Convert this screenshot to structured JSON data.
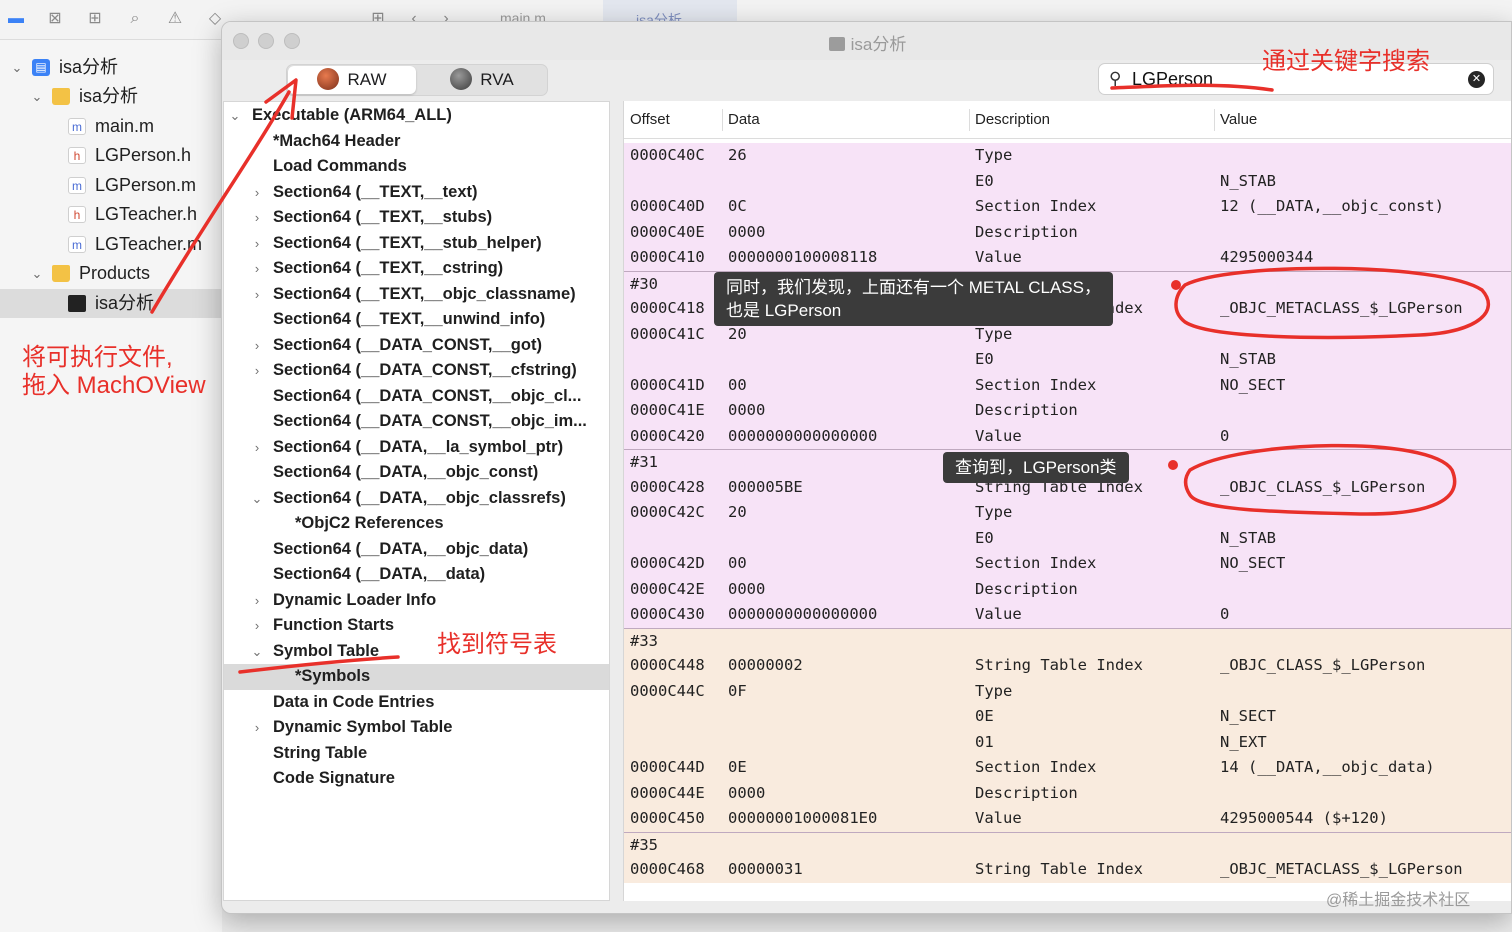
{
  "xcode": {
    "toolbar_icons": [
      "folder-icon",
      "x-square-icon",
      "hierarchy-icon",
      "search-icon",
      "warning-icon",
      "diamond-icon",
      "gear-icon",
      "tag-icon",
      "doc-icon",
      "grid-icon",
      "back-icon",
      "forward-icon"
    ],
    "tab_main": "main.m",
    "tab_isa": "isa分析",
    "navigator": [
      {
        "label": "isa分析",
        "type": "project",
        "chevron": "v"
      },
      {
        "label": "isa分析",
        "type": "folder",
        "chevron": "v"
      },
      {
        "label": "main.m",
        "type": "m"
      },
      {
        "label": "LGPerson.h",
        "type": "h"
      },
      {
        "label": "LGPerson.m",
        "type": "m"
      },
      {
        "label": "LGTeacher.h",
        "type": "h"
      },
      {
        "label": "LGTeacher.m",
        "type": "m"
      },
      {
        "label": "Products",
        "type": "folder",
        "chevron": "v"
      },
      {
        "label": "isa分析",
        "type": "exec",
        "selected": true
      }
    ]
  },
  "machoview": {
    "title": "isa分析",
    "segments": [
      {
        "label": "RAW",
        "selected": true
      },
      {
        "label": "RVA",
        "selected": false
      }
    ],
    "search": {
      "value": "LGPerson",
      "placeholder": "Search"
    },
    "tree": [
      {
        "label": "Executable  (ARM64_ALL)",
        "indent": 0,
        "chevron": "v"
      },
      {
        "label": "*Mach64 Header",
        "indent": 1,
        "chevron": ""
      },
      {
        "label": "Load Commands",
        "indent": 1,
        "chevron": ""
      },
      {
        "label": "Section64 (__TEXT,__text)",
        "indent": 1,
        "chevron": ">"
      },
      {
        "label": "Section64 (__TEXT,__stubs)",
        "indent": 1,
        "chevron": ">"
      },
      {
        "label": "Section64 (__TEXT,__stub_helper)",
        "indent": 1,
        "chevron": ">"
      },
      {
        "label": "Section64 (__TEXT,__cstring)",
        "indent": 1,
        "chevron": ">"
      },
      {
        "label": "Section64 (__TEXT,__objc_classname)",
        "indent": 1,
        "chevron": ">"
      },
      {
        "label": "Section64 (__TEXT,__unwind_info)",
        "indent": 1,
        "chevron": ""
      },
      {
        "label": "Section64 (__DATA_CONST,__got)",
        "indent": 1,
        "chevron": ">"
      },
      {
        "label": "Section64 (__DATA_CONST,__cfstring)",
        "indent": 1,
        "chevron": ">"
      },
      {
        "label": "Section64 (__DATA_CONST,__objc_cl...",
        "indent": 1,
        "chevron": ""
      },
      {
        "label": "Section64 (__DATA_CONST,__objc_im...",
        "indent": 1,
        "chevron": ""
      },
      {
        "label": "Section64 (__DATA,__la_symbol_ptr)",
        "indent": 1,
        "chevron": ">"
      },
      {
        "label": "Section64 (__DATA,__objc_const)",
        "indent": 1,
        "chevron": ""
      },
      {
        "label": "Section64 (__DATA,__objc_classrefs)",
        "indent": 1,
        "chevron": "v"
      },
      {
        "label": "*ObjC2 References",
        "indent": 2,
        "chevron": ""
      },
      {
        "label": "Section64 (__DATA,__objc_data)",
        "indent": 1,
        "chevron": ""
      },
      {
        "label": "Section64 (__DATA,__data)",
        "indent": 1,
        "chevron": ""
      },
      {
        "label": "Dynamic Loader Info",
        "indent": 1,
        "chevron": ">"
      },
      {
        "label": "Function Starts",
        "indent": 1,
        "chevron": ">"
      },
      {
        "label": "Symbol Table",
        "indent": 1,
        "chevron": "v"
      },
      {
        "label": "*Symbols",
        "indent": 2,
        "chevron": "",
        "selected": true
      },
      {
        "label": "Data in Code Entries",
        "indent": 1,
        "chevron": ""
      },
      {
        "label": "Dynamic Symbol Table",
        "indent": 1,
        "chevron": ">"
      },
      {
        "label": "String Table",
        "indent": 1,
        "chevron": ""
      },
      {
        "label": "Code Signature",
        "indent": 1,
        "chevron": ""
      }
    ],
    "columns": [
      "Offset",
      "Data",
      "Description",
      "Value"
    ],
    "rows": [
      {
        "offset": "0000C40C",
        "data": "26",
        "desc": "Type",
        "value": "",
        "bg": "pink"
      },
      {
        "offset": "",
        "data": "",
        "desc": "E0",
        "value": "N_STAB",
        "bg": "pink"
      },
      {
        "offset": "0000C40D",
        "data": "0C",
        "desc": "Section Index",
        "value": "12 (__DATA,__objc_const)",
        "bg": "pink"
      },
      {
        "offset": "0000C40E",
        "data": "0000",
        "desc": "Description",
        "value": "",
        "bg": "pink"
      },
      {
        "offset": "0000C410",
        "data": "0000000100008118",
        "desc": "Value",
        "value": "4295000344",
        "bg": "pink"
      },
      {
        "offset": "#30",
        "data": "",
        "desc": "",
        "value": "",
        "bg": "pink",
        "group": true
      },
      {
        "offset": "0000C418",
        "data": "0000031A",
        "desc": "String Table Index",
        "value": "_OBJC_METACLASS_$_LGPerson",
        "bg": "pink"
      },
      {
        "offset": "0000C41C",
        "data": "20",
        "desc": "Type",
        "value": "",
        "bg": "pink"
      },
      {
        "offset": "",
        "data": "",
        "desc": "E0",
        "value": "N_STAB",
        "bg": "pink"
      },
      {
        "offset": "0000C41D",
        "data": "00",
        "desc": "Section Index",
        "value": "NO_SECT",
        "bg": "pink"
      },
      {
        "offset": "0000C41E",
        "data": "0000",
        "desc": "Description",
        "value": "",
        "bg": "pink"
      },
      {
        "offset": "0000C420",
        "data": "0000000000000000",
        "desc": "Value",
        "value": "0",
        "bg": "pink"
      },
      {
        "offset": "#31",
        "data": "",
        "desc": "",
        "value": "",
        "bg": "pink",
        "group": true
      },
      {
        "offset": "0000C428",
        "data": "000005BE",
        "desc": "String Table Index",
        "value": "_OBJC_CLASS_$_LGPerson",
        "bg": "pink"
      },
      {
        "offset": "0000C42C",
        "data": "20",
        "desc": "Type",
        "value": "",
        "bg": "pink"
      },
      {
        "offset": "",
        "data": "",
        "desc": "E0",
        "value": "N_STAB",
        "bg": "pink"
      },
      {
        "offset": "0000C42D",
        "data": "00",
        "desc": "Section Index",
        "value": "NO_SECT",
        "bg": "pink"
      },
      {
        "offset": "0000C42E",
        "data": "0000",
        "desc": "Description",
        "value": "",
        "bg": "pink"
      },
      {
        "offset": "0000C430",
        "data": "0000000000000000",
        "desc": "Value",
        "value": "0",
        "bg": "pink"
      },
      {
        "offset": "#33",
        "data": "",
        "desc": "",
        "value": "",
        "bg": "peach",
        "group": true
      },
      {
        "offset": "0000C448",
        "data": "00000002",
        "desc": "String Table Index",
        "value": "_OBJC_CLASS_$_LGPerson",
        "bg": "peach"
      },
      {
        "offset": "0000C44C",
        "data": "0F",
        "desc": "Type",
        "value": "",
        "bg": "peach"
      },
      {
        "offset": "",
        "data": "",
        "desc": "0E",
        "value": "N_SECT",
        "bg": "peach"
      },
      {
        "offset": "",
        "data": "",
        "desc": "01",
        "value": "N_EXT",
        "bg": "peach"
      },
      {
        "offset": "0000C44D",
        "data": "0E",
        "desc": "Section Index",
        "value": "14 (__DATA,__objc_data)",
        "bg": "peach"
      },
      {
        "offset": "0000C44E",
        "data": "0000",
        "desc": "Description",
        "value": "",
        "bg": "peach"
      },
      {
        "offset": "0000C450",
        "data": "00000001000081E0",
        "desc": "Value",
        "value": "4295000544 ($+120)",
        "bg": "peach"
      },
      {
        "offset": "#35",
        "data": "",
        "desc": "",
        "value": "",
        "bg": "peach",
        "group": true
      },
      {
        "offset": "0000C468",
        "data": "00000031",
        "desc": "String Table Index",
        "value": "_OBJC_METACLASS_$_LGPerson",
        "bg": "peach"
      }
    ]
  },
  "annotations": {
    "search_hint": "通过关键字搜索",
    "drag_hint_line1": "将可执行文件,",
    "drag_hint_line2": "拖入 MachOView",
    "symbol_hint": "找到符号表",
    "tooltip_metaclass_line1": "同时，我们发现，上面还有一个 METAL CLASS，",
    "tooltip_metaclass_line2": "也是 LGPerson",
    "tooltip_class": "查询到，LGPerson类"
  },
  "watermark": "@稀土掘金技术社区",
  "colors": {
    "annotation": "#e8302a",
    "row_pink": "#f7e3f7",
    "row_peach": "#f9ebde",
    "tooltip_bg": "#3b3b3b"
  }
}
